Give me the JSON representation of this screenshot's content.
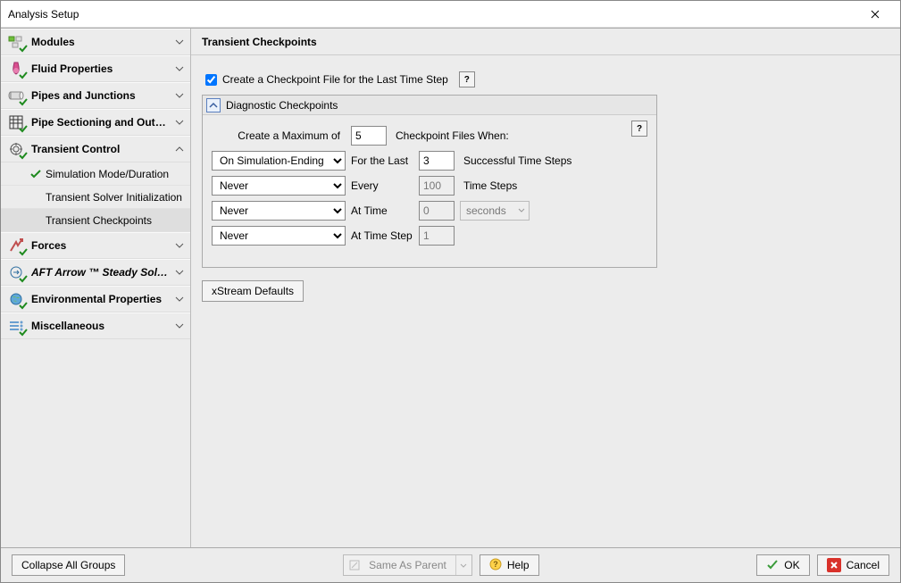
{
  "window": {
    "title": "Analysis Setup"
  },
  "sidebar": {
    "groups": [
      {
        "label": "Modules",
        "expanded": false
      },
      {
        "label": "Fluid Properties",
        "expanded": false
      },
      {
        "label": "Pipes and Junctions",
        "expanded": false
      },
      {
        "label": "Pipe Sectioning and Output",
        "expanded": false
      },
      {
        "label": "Transient Control",
        "expanded": true,
        "items": [
          {
            "label": "Simulation Mode/Duration",
            "valid": true,
            "selected": false
          },
          {
            "label": "Transient Solver Initialization",
            "valid": false,
            "selected": false
          },
          {
            "label": "Transient Checkpoints",
            "valid": false,
            "selected": true
          }
        ]
      },
      {
        "label": "Forces",
        "expanded": false
      },
      {
        "label": "AFT Arrow ™ Steady Solution",
        "italic": true,
        "expanded": false
      },
      {
        "label": "Environmental Properties",
        "expanded": false
      },
      {
        "label": "Miscellaneous",
        "expanded": false
      }
    ]
  },
  "content": {
    "header": "Transient Checkpoints",
    "checkpoint_checkbox_label": "Create a Checkpoint File for the Last Time Step",
    "checkpoint_checked": true,
    "diagnostic": {
      "title": "Diagnostic Checkpoints",
      "max_label_left": "Create a Maximum of",
      "max_value": "5",
      "max_label_right": "Checkpoint Files When:",
      "rows": [
        {
          "trigger": "On Simulation-Ending Error",
          "label": "For the Last",
          "value": "3",
          "suffix": "Successful Time Steps",
          "disabled": false
        },
        {
          "trigger": "Never",
          "label": "Every",
          "value": "100",
          "suffix": "Time Steps",
          "disabled": true
        },
        {
          "trigger": "Never",
          "label": "At Time",
          "value": "0",
          "suffix": "seconds",
          "unit_dropdown": true,
          "disabled": true
        },
        {
          "trigger": "Never",
          "label": "At Time Step",
          "value": "1",
          "suffix": "",
          "disabled": true
        }
      ],
      "trigger_options": [
        "On Simulation-Ending Error",
        "Never"
      ]
    },
    "defaults_btn": "xStream Defaults"
  },
  "footer": {
    "collapse": "Collapse All Groups",
    "same_as_parent": "Same As Parent",
    "help": "Help",
    "ok": "OK",
    "cancel": "Cancel"
  }
}
